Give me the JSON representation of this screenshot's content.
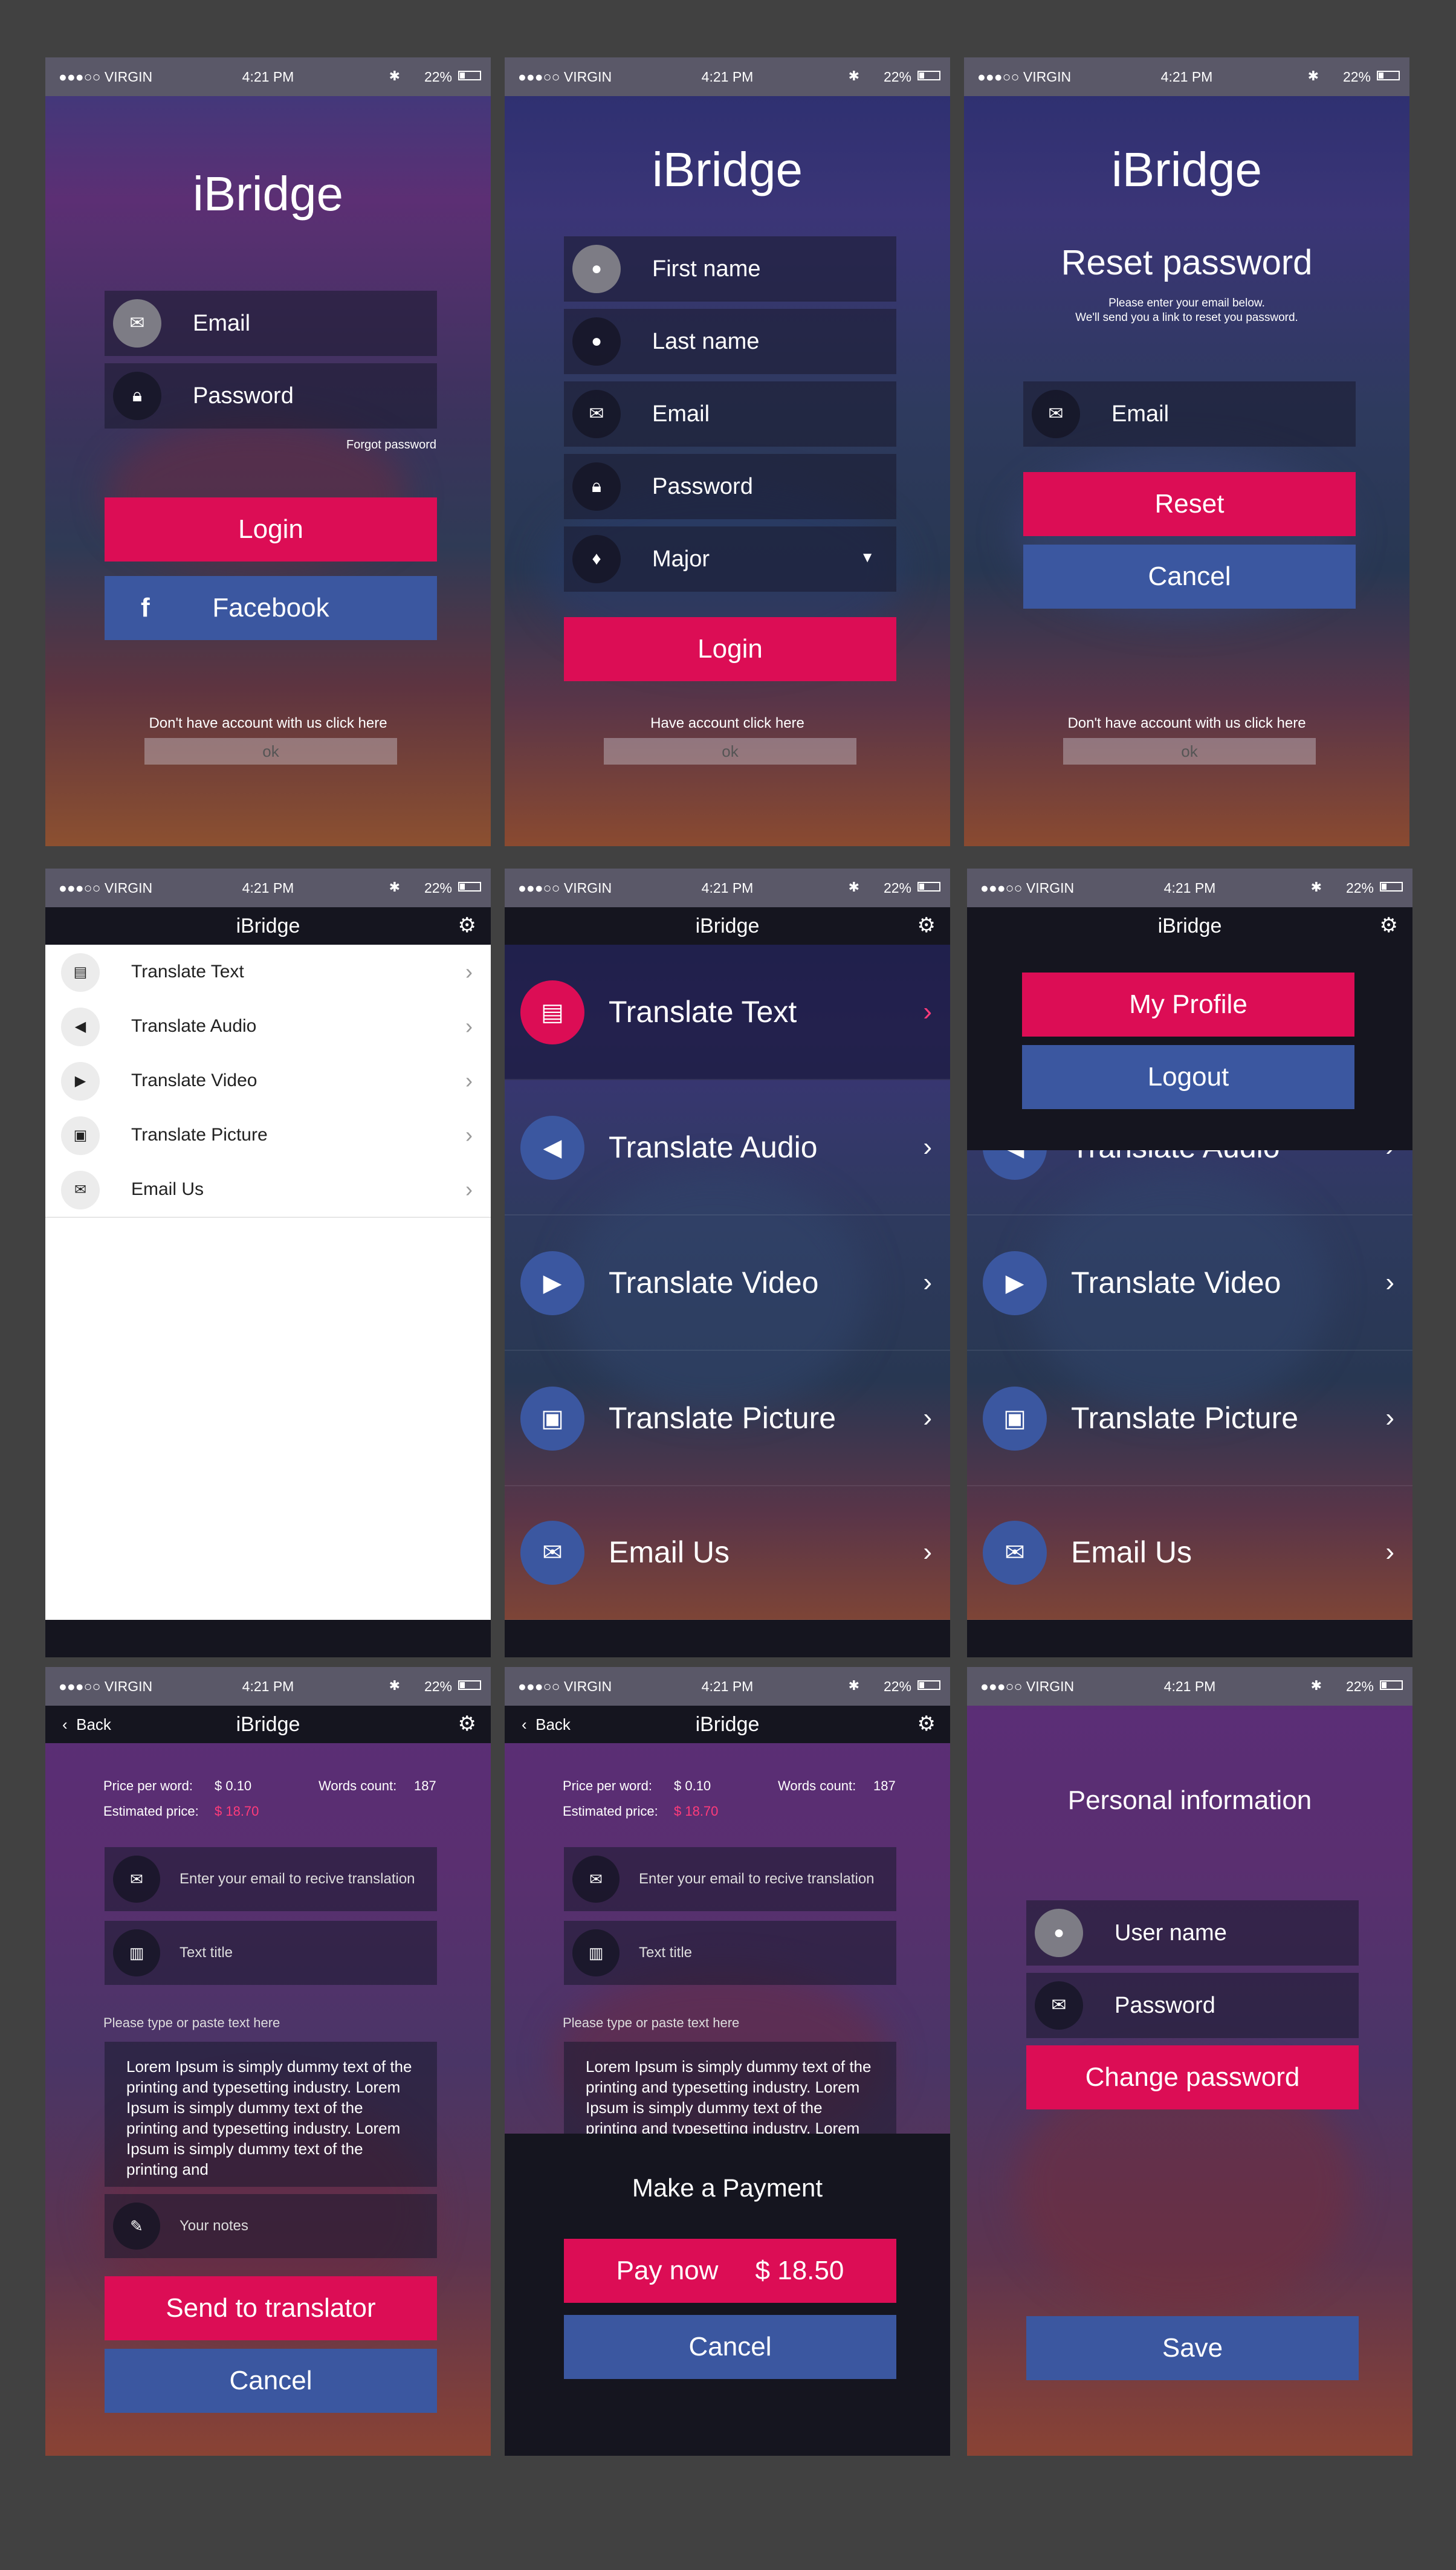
{
  "status": {
    "carrier": "●●●○○ VIRGIN",
    "time": "4:21 PM",
    "battery": "22%",
    "bluetooth": "✱"
  },
  "app_name": "iBridge",
  "login": {
    "email": "Email",
    "password": "Password",
    "forgot": "Forgot password",
    "login_btn": "Login",
    "facebook_btn": "Facebook",
    "signup_text": "Don't have account with us click here",
    "ok": "ok"
  },
  "register": {
    "first_name": "First name",
    "last_name": "Last name",
    "email": "Email",
    "password": "Password",
    "major": "Major",
    "login_btn": "Login",
    "have_account": "Have account click here",
    "ok": "ok"
  },
  "reset": {
    "title": "Reset password",
    "line1": "Please enter your email below.",
    "line2": "We'll send you a link to reset you password.",
    "email": "Email",
    "reset_btn": "Reset",
    "cancel_btn": "Cancel",
    "signup_text": "Don't have account with us click here",
    "ok": "ok"
  },
  "menu": {
    "items": [
      "Translate Text",
      "Translate Audio",
      "Translate Video",
      "Translate Picture",
      "Email Us"
    ]
  },
  "profile_menu": {
    "my_profile": "My Profile",
    "logout": "Logout"
  },
  "translate": {
    "back": "Back",
    "price_label": "Price per word:",
    "price_value": "$ 0.10",
    "words_label": "Words count:",
    "words_value": "187",
    "est_label": "Estimated price:",
    "est_value": "$ 18.70",
    "email_placeholder": "Enter your email to recive translation",
    "title_placeholder": "Text title",
    "paste_hint": "Please type or paste text here",
    "body": "Lorem Ipsum is simply dummy text of the printing and typesetting industry. Lorem Ipsum is simply dummy text of the printing and typesetting industry. Lorem Ipsum is simply dummy text of the printing and",
    "notes_placeholder": "Your notes",
    "send_btn": "Send to translator",
    "cancel_btn": "Cancel"
  },
  "payment": {
    "title": "Make a Payment",
    "pay_btn": "Pay now     $ 18.50",
    "cancel_btn": "Cancel"
  },
  "personal": {
    "title": "Personal information",
    "username": "User name",
    "password": "Password",
    "change_btn": "Change password",
    "save_btn": "Save"
  },
  "colors": {
    "pink": "#dc0d55",
    "blue": "#3b57a0",
    "dark": "#15151f",
    "page_bg": "#414141"
  }
}
